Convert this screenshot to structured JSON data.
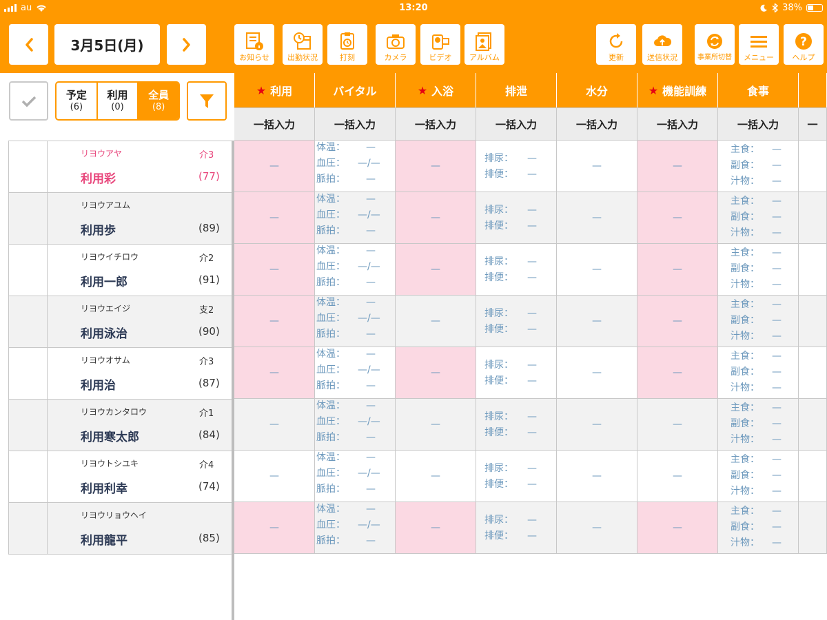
{
  "status_bar": {
    "carrier": "au",
    "time": "13:20",
    "battery": "38%",
    "battery_level": 0.38
  },
  "header": {
    "date": "3月5日(月)",
    "tools": [
      {
        "label": "お知らせ",
        "icon": "notice-icon"
      },
      {
        "label": "出勤状況",
        "icon": "attendance-icon"
      },
      {
        "label": "打刻",
        "icon": "timestamp-icon"
      },
      {
        "label": "カメラ",
        "icon": "camera-icon"
      },
      {
        "label": "ビデオ",
        "icon": "video-icon"
      },
      {
        "label": "アルバム",
        "icon": "album-icon"
      },
      {
        "label": "更新",
        "icon": "refresh-icon"
      },
      {
        "label": "送信状況",
        "icon": "cloud-upload-icon"
      },
      {
        "label": "事業所切替",
        "icon": "office-switch-icon"
      },
      {
        "label": "メニュー",
        "icon": "menu-icon"
      },
      {
        "label": "ヘルプ",
        "icon": "help-icon"
      }
    ]
  },
  "filters": {
    "segments": [
      {
        "label": "予定",
        "count": "(6)"
      },
      {
        "label": "利用",
        "count": "(0)"
      },
      {
        "label": "全員",
        "count": "(8)"
      }
    ],
    "active_segment": "全員"
  },
  "columns": [
    {
      "label": "利用",
      "star": true
    },
    {
      "label": "バイタル",
      "star": false
    },
    {
      "label": "入浴",
      "star": true
    },
    {
      "label": "排泄",
      "star": false
    },
    {
      "label": "水分",
      "star": false
    },
    {
      "label": "機能訓練",
      "star": true
    },
    {
      "label": "食事",
      "star": false
    },
    {
      "label": "",
      "star": false
    }
  ],
  "bulk_label": "一括入力",
  "bulk_partial": "一",
  "star_char": "★",
  "labels": {
    "dash": "—",
    "bp": "—/—",
    "vital": [
      "体温：",
      "血圧：",
      "脈拍："
    ],
    "excretion": [
      "排尿：",
      "排便："
    ],
    "meal": [
      "主食：",
      "副食：",
      "汁物："
    ]
  },
  "users": [
    {
      "kana": "リヨウアヤ",
      "care": "介3",
      "name": "利用彩",
      "age": "(77)",
      "highlight": true,
      "pink": [
        true,
        true,
        true
      ]
    },
    {
      "kana": "リヨウアユム",
      "care": "",
      "name": "利用歩",
      "age": "(89)",
      "highlight": false,
      "pink": [
        true,
        true,
        true
      ]
    },
    {
      "kana": "リヨウイチロウ",
      "care": "介2",
      "name": "利用一郎",
      "age": "(91)",
      "highlight": false,
      "pink": [
        true,
        true,
        true
      ]
    },
    {
      "kana": "リヨウエイジ",
      "care": "支2",
      "name": "利用泳治",
      "age": "(90)",
      "highlight": false,
      "pink": [
        true,
        false,
        true
      ]
    },
    {
      "kana": "リヨウオサム",
      "care": "介3",
      "name": "利用治",
      "age": "(87)",
      "highlight": false,
      "pink": [
        true,
        true,
        true
      ]
    },
    {
      "kana": "リヨウカンタロウ",
      "care": "介1",
      "name": "利用寒太郎",
      "age": "(84)",
      "highlight": false,
      "pink": [
        false,
        false,
        false
      ]
    },
    {
      "kana": "リヨウトシユキ",
      "care": "介4",
      "name": "利用利幸",
      "age": "(74)",
      "highlight": false,
      "pink": [
        false,
        false,
        false
      ]
    },
    {
      "kana": "リヨウリョウヘイ",
      "care": "",
      "name": "利用龍平",
      "age": "(85)",
      "highlight": false,
      "pink": [
        true,
        true,
        true
      ]
    }
  ],
  "colors": {
    "accent": "#ff9900",
    "pink_cell": "#fbd9e3",
    "highlight_text": "#e8457b",
    "value_text": "#6d99bd",
    "star": "#e60012"
  }
}
